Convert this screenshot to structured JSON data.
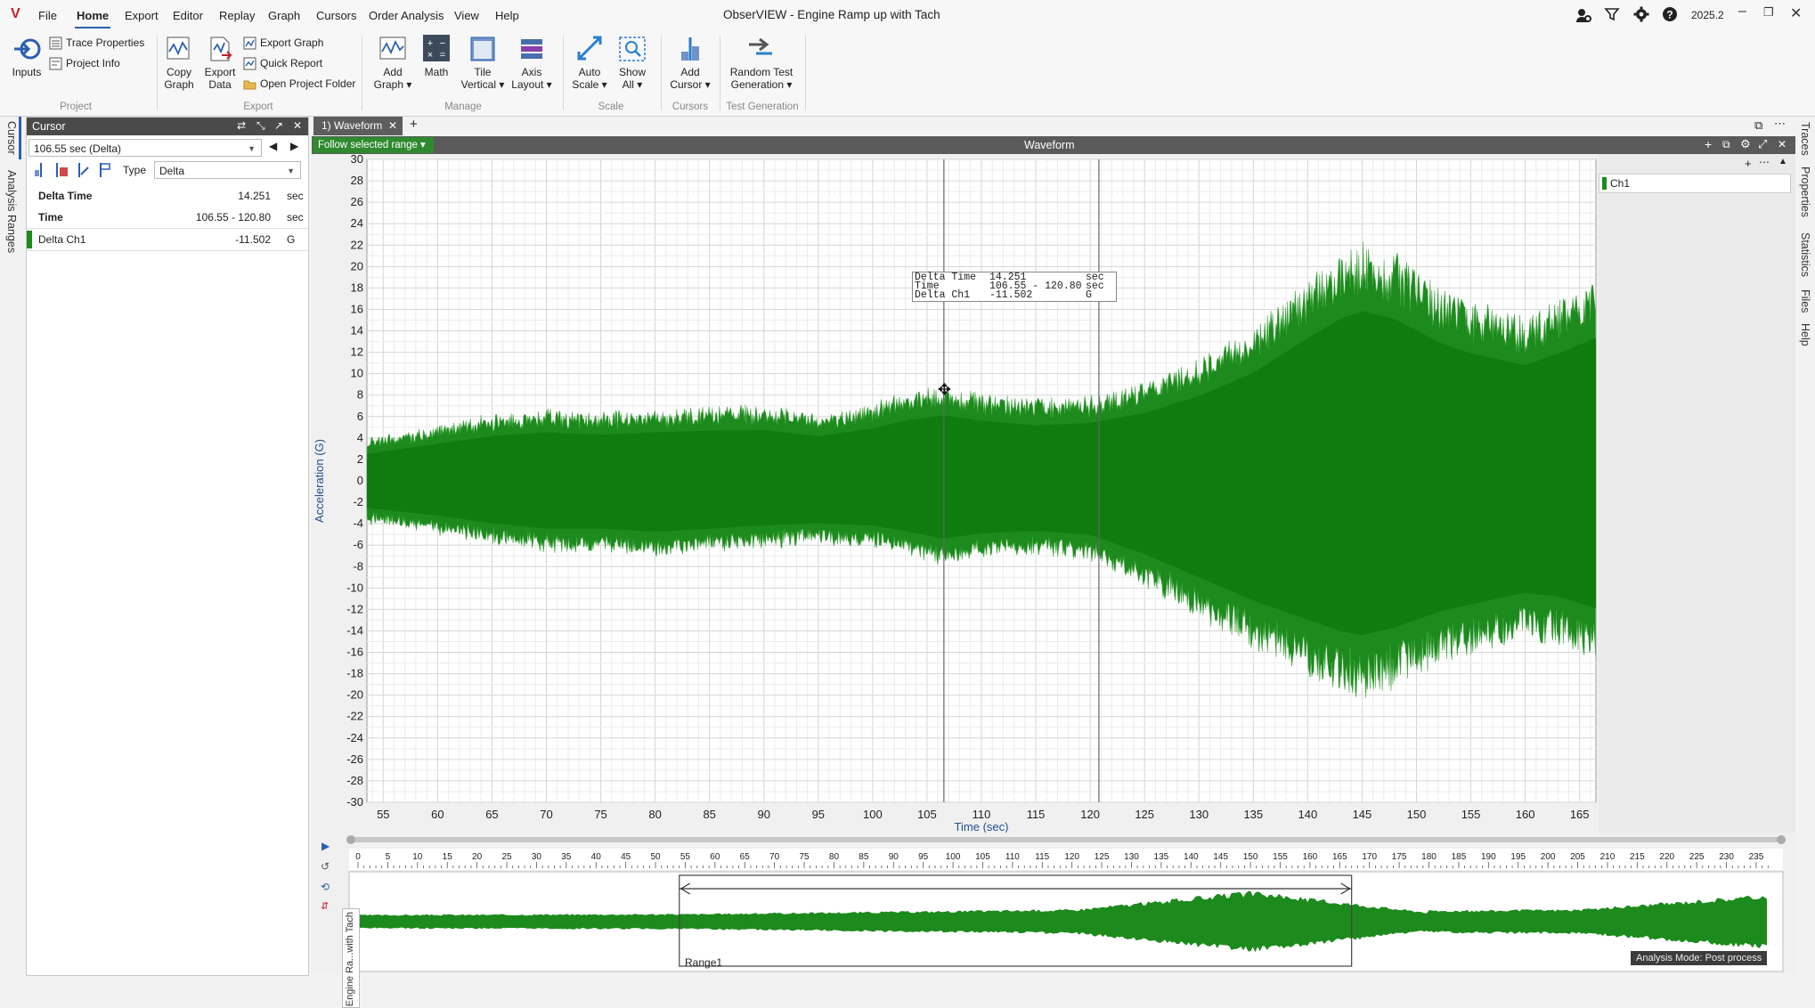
{
  "app": {
    "window_title": "ObserVIEW - Engine Ramp up with Tach",
    "version": "2025.2"
  },
  "menu": {
    "items": [
      "File",
      "Home",
      "Export",
      "Editor",
      "Replay",
      "Graph",
      "Cursors",
      "Order Analysis",
      "View",
      "Help"
    ],
    "active": "Home"
  },
  "ribbon": {
    "project": {
      "group_label": "Project",
      "inputs_label": "Inputs",
      "trace_properties_label": "Trace Properties",
      "project_info_label": "Project Info"
    },
    "export": {
      "group_label": "Export",
      "copy_graph_label": "Copy\nGraph",
      "export_data_label": "Export\nData",
      "export_graph_label": "Export Graph",
      "quick_report_label": "Quick Report",
      "open_project_folder_label": "Open Project Folder"
    },
    "manage": {
      "group_label": "Manage",
      "add_graph_label": "Add\nGraph ▾",
      "math_label": "Math",
      "tile_vertical_label": "Tile\nVertical ▾",
      "axis_layout_label": "Axis\nLayout ▾"
    },
    "scale": {
      "group_label": "Scale",
      "auto_scale_label": "Auto\nScale ▾",
      "show_all_label": "Show\nAll ▾"
    },
    "cursors": {
      "group_label": "Cursors",
      "add_cursor_label": "Add\nCursor ▾"
    },
    "test_generation": {
      "group_label": "Test Generation",
      "random_test_label": "Random Test\nGeneration ▾"
    }
  },
  "left_tabs": [
    "Cursor",
    "Analysis Ranges"
  ],
  "right_tabs": [
    "Traces",
    "Properties",
    "Statistics",
    "Files",
    "Help"
  ],
  "cursor_panel": {
    "title": "Cursor",
    "selector_value": "106.55 sec (Delta)",
    "type_label": "Type",
    "type_value": "Delta",
    "rows": [
      {
        "label": "Delta Time",
        "value": "14.251",
        "unit": "sec",
        "color": ""
      },
      {
        "label": "Time",
        "value": "106.55 - 120.80",
        "unit": "sec",
        "color": ""
      },
      {
        "label": "Delta Ch1",
        "value": "-11.502",
        "unit": "G",
        "color": "#1d8a1d"
      }
    ]
  },
  "doc": {
    "tab_label": "1) Waveform",
    "panel_title": "Waveform",
    "follow_label": "Follow selected range ▾"
  },
  "legend": {
    "entries": [
      {
        "name": "Ch1",
        "color": "#1d8a1d"
      }
    ]
  },
  "tooltip": {
    "lines": [
      {
        "label": "Delta Time",
        "value": "14.251",
        "unit": "sec"
      },
      {
        "label": "Time",
        "value": "106.55 - 120.80",
        "unit": "sec"
      },
      {
        "label": "Delta Ch1",
        "value": "-11.502",
        "unit": "G"
      }
    ]
  },
  "chart_data": {
    "type": "area",
    "xlabel": "Time (sec)",
    "ylabel": "Acceleration (G)",
    "xlim": [
      53.5,
      166.5
    ],
    "ylim": [
      -30,
      30
    ],
    "x_ticks": [
      55,
      60,
      65,
      70,
      75,
      80,
      85,
      90,
      95,
      100,
      105,
      110,
      115,
      120,
      125,
      130,
      135,
      140,
      145,
      150,
      155,
      160,
      165
    ],
    "y_ticks": [
      30,
      28,
      26,
      24,
      22,
      20,
      18,
      16,
      14,
      12,
      10,
      8,
      6,
      4,
      2,
      0,
      -2,
      -4,
      -6,
      -8,
      -10,
      -12,
      -14,
      -16,
      -18,
      -20,
      -22,
      -24,
      -26,
      -28,
      -30
    ],
    "grid": true,
    "series": [
      {
        "name": "Ch1",
        "color": "#1d8a1d",
        "x": [
          53.5,
          60,
          65,
          70,
          75,
          80,
          85,
          90,
          95,
          100,
          103,
          106.5,
          110,
          115,
          120,
          125,
          130,
          135,
          140,
          143,
          145,
          148,
          152,
          155,
          160,
          163,
          166.5
        ],
        "upper": [
          3.5,
          4.8,
          5.8,
          6.3,
          6.0,
          6.3,
          6.5,
          6.6,
          5.8,
          6.8,
          7.8,
          8.5,
          7.8,
          7.2,
          7.5,
          8.8,
          11.0,
          14.0,
          18.5,
          21.0,
          22.0,
          21.0,
          18.0,
          16.5,
          15.0,
          16.5,
          18.5
        ],
        "lower": [
          -3.5,
          -4.5,
          -5.5,
          -6.2,
          -6.2,
          -6.6,
          -6.2,
          -5.8,
          -5.5,
          -5.8,
          -6.5,
          -7.5,
          -6.8,
          -6.5,
          -7.0,
          -9.5,
          -12.5,
          -15.5,
          -18.0,
          -19.5,
          -20.0,
          -19.0,
          -17.0,
          -16.0,
          -14.5,
          -15.0,
          -16.5
        ]
      }
    ],
    "cursors": [
      106.55,
      120.8
    ]
  },
  "overview": {
    "x_ticks": [
      0,
      5,
      10,
      15,
      20,
      25,
      30,
      35,
      40,
      45,
      50,
      55,
      60,
      65,
      70,
      75,
      80,
      85,
      90,
      95,
      100,
      105,
      110,
      115,
      120,
      125,
      130,
      135,
      140,
      145,
      150,
      155,
      160,
      165,
      170,
      175,
      180,
      185,
      190,
      195,
      200,
      205,
      210,
      215,
      220,
      225,
      230,
      235
    ],
    "xlim": [
      0,
      238
    ],
    "trace_label": "Engine Ra...with Tach",
    "range_name": "Range1",
    "range": [
      54,
      167
    ],
    "status": "Analysis Mode: Post process"
  }
}
